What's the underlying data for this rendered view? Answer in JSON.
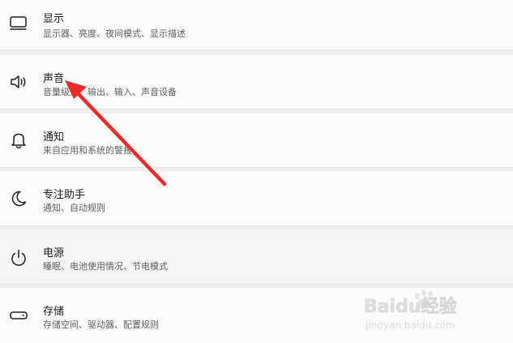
{
  "settings": {
    "items": [
      {
        "title": "显示",
        "subtitle": "显示器、亮度、夜间模式、显示描述",
        "icon": "monitor-icon"
      },
      {
        "title": "声音",
        "subtitle": "音量级别、输出、输入、声音设备",
        "icon": "speaker-icon"
      },
      {
        "title": "通知",
        "subtitle": "来自应用和系统的警报",
        "icon": "bell-icon"
      },
      {
        "title": "专注助手",
        "subtitle": "通知、自动规则",
        "icon": "moon-icon"
      },
      {
        "title": "电源",
        "subtitle": "睡眠、电池使用情况、节电模式",
        "icon": "power-icon"
      },
      {
        "title": "存储",
        "subtitle": "存储空间、驱动器、配置规则",
        "icon": "drive-icon"
      }
    ]
  },
  "annotation": {
    "color": "#ee2b2b"
  },
  "watermark": {
    "brand": "Baidu经验",
    "url": "jingyan.baidu.com"
  }
}
